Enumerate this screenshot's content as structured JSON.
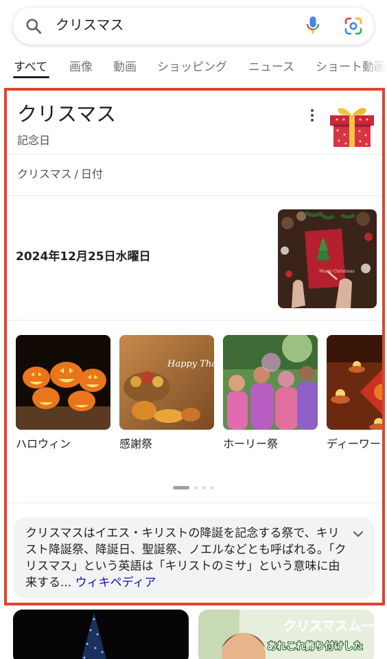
{
  "search": {
    "query": "クリスマス"
  },
  "tabs": [
    {
      "label": "すべて"
    },
    {
      "label": "画像"
    },
    {
      "label": "動画"
    },
    {
      "label": "ショッピング"
    },
    {
      "label": "ニュース"
    },
    {
      "label": "ショート動画"
    }
  ],
  "panel": {
    "title": "クリスマス",
    "subtitle": "記念日",
    "breadcrumb": {
      "first": "クリスマス",
      "separator": "/",
      "second": "日付"
    },
    "date": "2024年12月25日水曜日",
    "photo_card_text": "Merry Christmas",
    "related": [
      {
        "label": "ハロウィン"
      },
      {
        "label": "感謝祭",
        "image_text": "Happy Thanksgiving"
      },
      {
        "label": "ホーリー祭"
      },
      {
        "label": "ディーワーリー"
      }
    ],
    "description": "クリスマスはイエス・キリストの降誕を記念する祭で、キリスト降誕祭、降誕日、聖誕祭、ノエルなどとも呼ばれる。「クリスマス」という英語は「キリストのミサ」という意味に由来する",
    "ellipsis": "...",
    "source_link": "ウィキペディア"
  },
  "videos": [
    {
      "caption": ""
    },
    {
      "caption_top": "クリスマスムード",
      "caption_bottom": "あれこれ飾り付けした"
    }
  ],
  "colors": {
    "highlight_border": "#e0432c",
    "link": "#1a0dab",
    "text_primary": "#202124",
    "text_secondary": "#70757a"
  },
  "icons": [
    "search-icon",
    "mic-icon",
    "lens-icon",
    "more-vert-icon",
    "expand-icon"
  ]
}
